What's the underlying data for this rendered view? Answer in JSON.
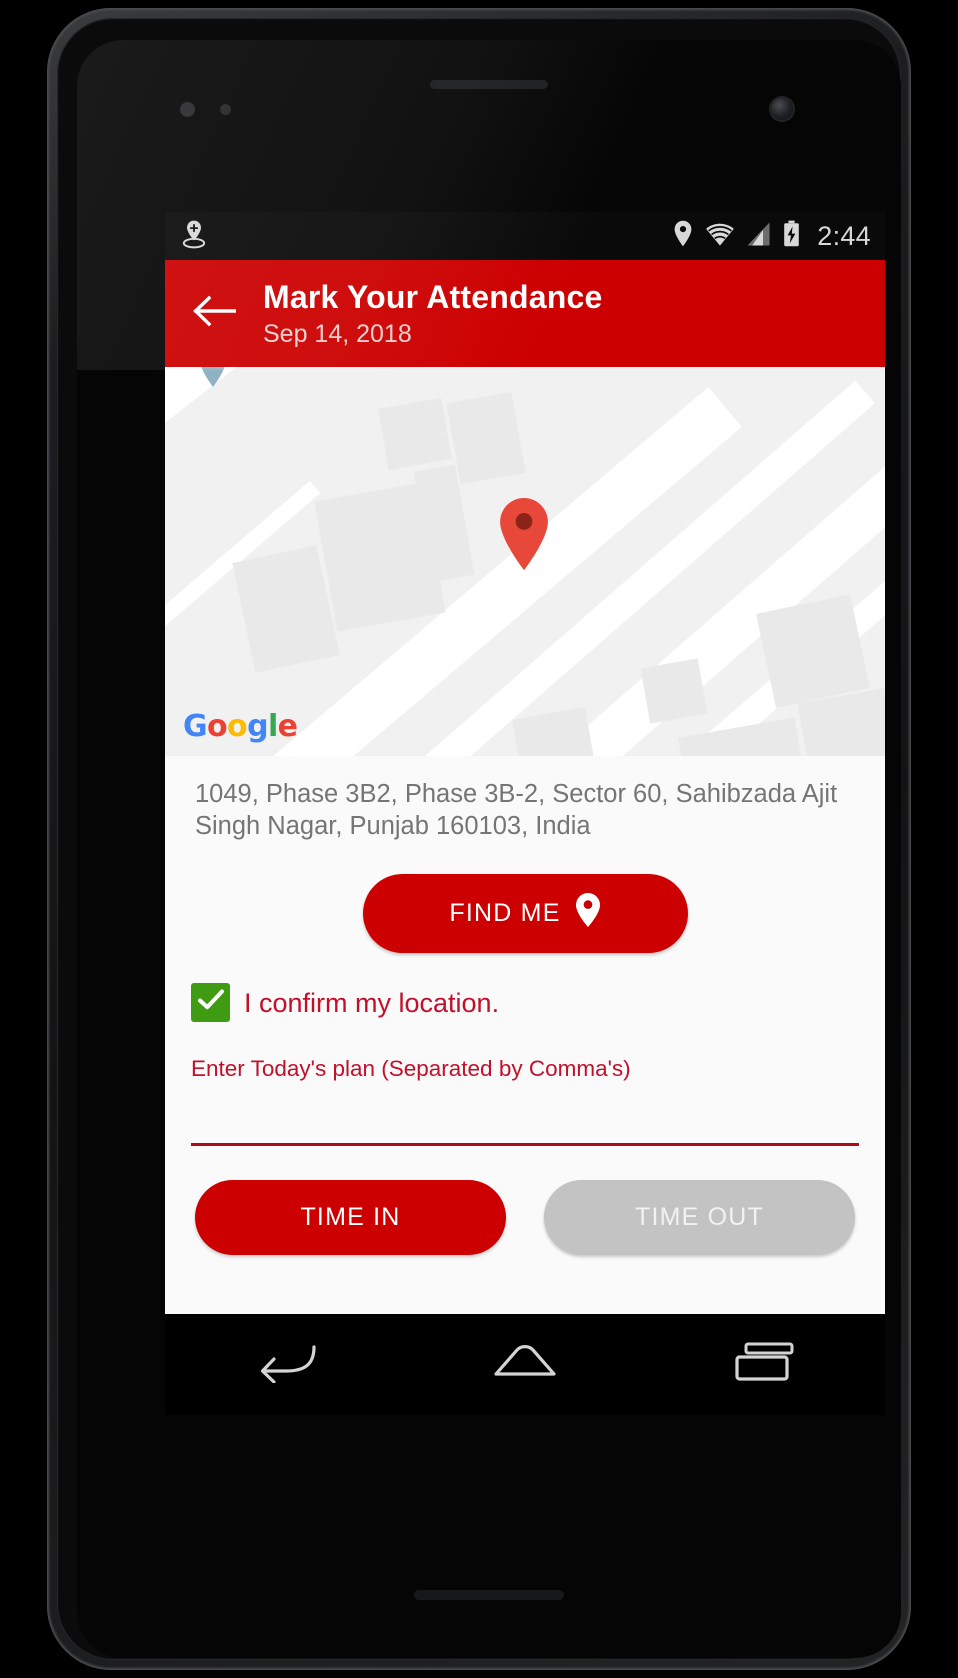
{
  "status_bar": {
    "left_icons": [
      "location-sharing-icon"
    ],
    "right_icons": [
      "location-pin-icon",
      "wifi-icon",
      "cellular-signal-icon",
      "battery-charging-icon"
    ],
    "time": "2:44"
  },
  "app_bar": {
    "back_icon": "back-arrow-icon",
    "title": "Mark Your Attendance",
    "subtitle": "Sep 14, 2018",
    "background_color": "#cc0000"
  },
  "map": {
    "provider_logo": {
      "letters": [
        "G",
        "o",
        "o",
        "g",
        "l",
        "e"
      ],
      "text": "Google"
    },
    "marker_icon": "map-pin-marker",
    "marker_color": "#e8483a",
    "secondary_marker_color": "#8fb3c4",
    "background_color": "#f1f1f1",
    "road_color": "#ffffff",
    "building_color": "#e9e9e9"
  },
  "location": {
    "address": "1049, Phase 3B2, Phase 3B-2, Sector 60, Sahibzada Ajit Singh Nagar, Punjab 160103, India"
  },
  "find_me": {
    "label": "FIND ME",
    "icon": "location-pin-icon",
    "color": "#cc0000"
  },
  "confirm": {
    "checked": true,
    "label": "I confirm my location.",
    "checkbox_color": "#3f9c12",
    "text_color": "#c2102a"
  },
  "plan": {
    "hint": "Enter Today's plan (Separated by Comma's)",
    "value": "",
    "placeholder": "",
    "underline_color": "#b00b16"
  },
  "actions": {
    "time_in": {
      "label": "TIME IN",
      "enabled": true,
      "color": "#cc0000"
    },
    "time_out": {
      "label": "TIME OUT",
      "enabled": false,
      "color": "#c3c3c3"
    }
  },
  "nav_bar": {
    "items": [
      {
        "name": "back",
        "icon": "nav-back-icon"
      },
      {
        "name": "home",
        "icon": "nav-home-icon"
      },
      {
        "name": "recents",
        "icon": "nav-recents-icon"
      }
    ]
  }
}
